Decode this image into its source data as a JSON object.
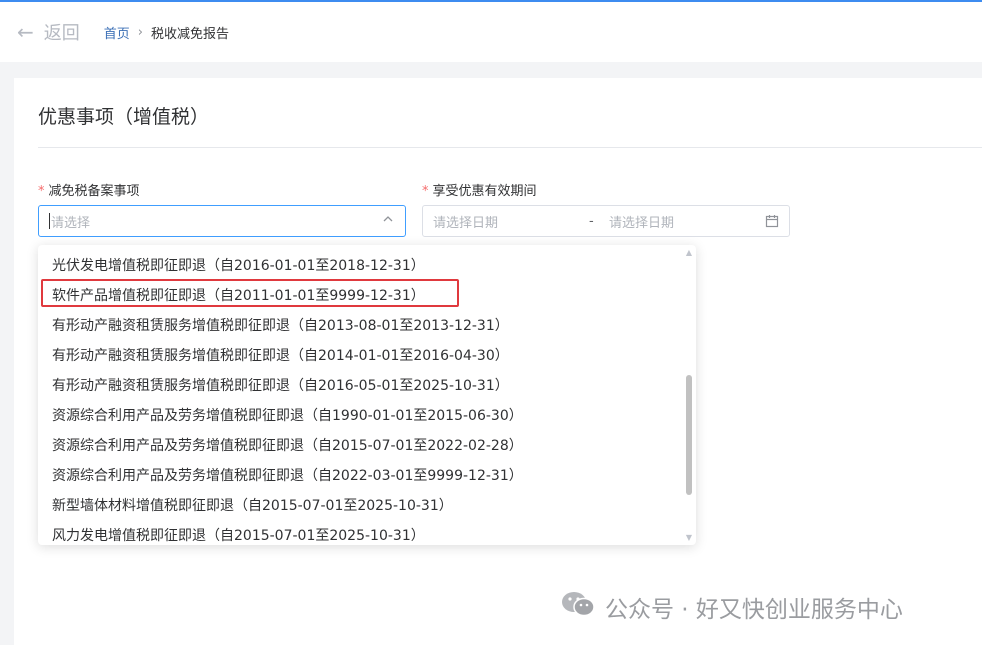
{
  "topbar": {
    "back_label": "返回",
    "breadcrumb": {
      "home": "首页",
      "separator": "›",
      "current": "税收减免报告"
    }
  },
  "form": {
    "section_title": "优惠事项（增值税）",
    "field1": {
      "required": "*",
      "label": "减免税备案事项",
      "placeholder": "请选择"
    },
    "field2": {
      "required": "*",
      "label": "享受优惠有效期间",
      "start_placeholder": "请选择日期",
      "separator": "-",
      "end_placeholder": "请选择日期"
    }
  },
  "dropdown": {
    "highlighted_index": 1,
    "options": [
      "光伏发电增值税即征即退（自2016-01-01至2018-12-31）",
      "软件产品增值税即征即退（自2011-01-01至9999-12-31）",
      "有形动产融资租赁服务增值税即征即退（自2013-08-01至2013-12-31）",
      "有形动产融资租赁服务增值税即征即退（自2014-01-01至2016-04-30）",
      "有形动产融资租赁服务增值税即征即退（自2016-05-01至2025-10-31）",
      "资源综合利用产品及劳务增值税即征即退（自1990-01-01至2015-06-30）",
      "资源综合利用产品及劳务增值税即征即退（自2015-07-01至2022-02-28）",
      "资源综合利用产品及劳务增值税即征即退（自2022-03-01至9999-12-31）",
      "新型墙体材料增值税即征即退（自2015-07-01至2025-10-31）",
      "风力发电增值税即征即退（自2015-07-01至2025-10-31）"
    ]
  },
  "watermark": {
    "text": "公众号 · 好又快创业服务中心"
  },
  "colors": {
    "accent": "#409eff",
    "required": "#f56c6c",
    "highlight_border": "#e0393e"
  }
}
